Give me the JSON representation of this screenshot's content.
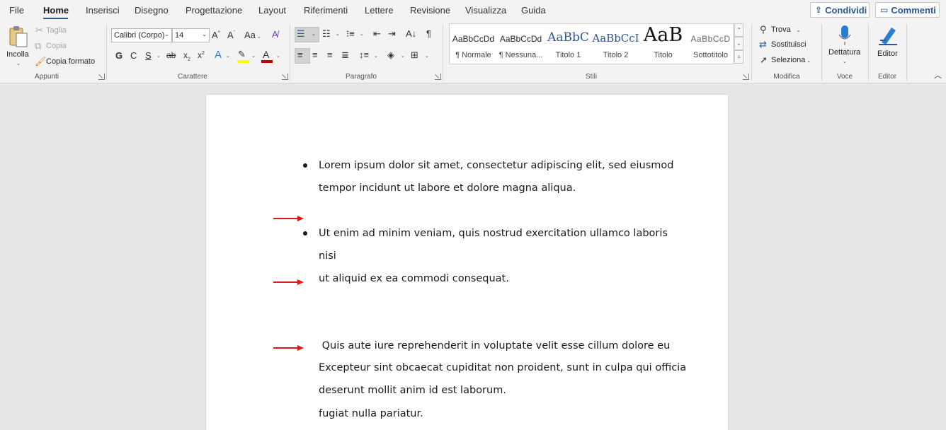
{
  "menu": {
    "tabs": [
      "File",
      "Home",
      "Inserisci",
      "Disegno",
      "Progettazione",
      "Layout",
      "Riferimenti",
      "Lettere",
      "Revisione",
      "Visualizza",
      "Guida"
    ],
    "share_label": "Condividi",
    "comments_label": "Commenti"
  },
  "ribbon": {
    "clipboard": {
      "paste": "Incolla",
      "cut": "Taglia",
      "copy": "Copia",
      "format_painter": "Copia formato",
      "group": "Appunti"
    },
    "font": {
      "family": "Calibri (Corpo)",
      "size": "14",
      "bold": "G",
      "italic": "C",
      "underline": "S",
      "strike": "ab",
      "case": "Aa",
      "group": "Carattere"
    },
    "paragraph": {
      "group": "Paragrafo"
    },
    "styles": {
      "items": [
        {
          "sample": "AaBbCcDd",
          "name": "¶ Normale"
        },
        {
          "sample": "AaBbCcDd",
          "name": "¶ Nessuna..."
        },
        {
          "sample": "AaBbC",
          "name": "Titolo 1"
        },
        {
          "sample": "AaBbCcI",
          "name": "Titolo 2"
        },
        {
          "sample": "AaB",
          "name": "Titolo"
        },
        {
          "sample": "AaBbCcD",
          "name": "Sottotitolo"
        }
      ],
      "group": "Stili"
    },
    "editing": {
      "find": "Trova",
      "replace": "Sostituisci",
      "select": "Seleziona",
      "group": "Modifica"
    },
    "voice": {
      "dictate": "Dettatura",
      "group": "Voce"
    },
    "editor": {
      "label": "Editor",
      "group": "Editor"
    }
  },
  "document": {
    "paragraphs": [
      {
        "line1": "Lorem ipsum dolor sit amet, consectetur adipiscing elit, sed eiusmod",
        "line2": "tempor incidunt ut labore et dolore magna aliqua."
      },
      {
        "line1": "Ut enim ad minim veniam, quis nostrud exercitation ullamco laboris nisi",
        "line2": "ut aliquid ex ea commodi consequat."
      },
      {
        "line1": " Quis aute iure reprehenderit in voluptate velit esse cillum dolore eu",
        "line2": "fugiat nulla pariatur."
      },
      {
        "line1": "Excepteur sint obcaecat cupiditat non proident, sunt in culpa qui officia",
        "line2": "deserunt mollit anim id est laborum."
      }
    ]
  },
  "colors": {
    "accent": "#2b579a",
    "annotation_arrow": "#e0181b",
    "highlight": "#ffff00",
    "font_color": "#c00000"
  }
}
